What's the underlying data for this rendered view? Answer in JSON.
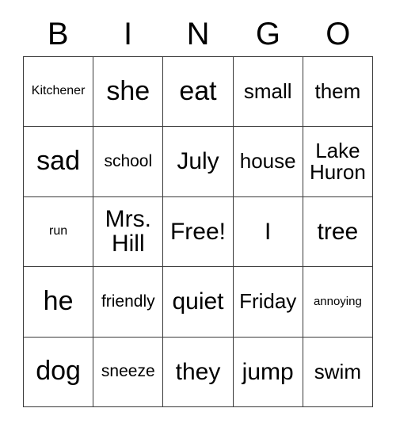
{
  "card": {
    "title_letters": [
      "B",
      "I",
      "N",
      "G",
      "O"
    ],
    "columns": 5,
    "rows": 5,
    "free_space_label": "Free!",
    "border_color": "#3a3a3a",
    "background_color": "#ffffff",
    "text_color": "#000000",
    "cells": [
      [
        {
          "text": "Kitchener",
          "size": "xs"
        },
        {
          "text": "she",
          "size": "xl"
        },
        {
          "text": "eat",
          "size": "xl"
        },
        {
          "text": "small",
          "size": "md"
        },
        {
          "text": "them",
          "size": "md"
        }
      ],
      [
        {
          "text": "sad",
          "size": "xl"
        },
        {
          "text": "school",
          "size": "sm"
        },
        {
          "text": "July",
          "size": "lg"
        },
        {
          "text": "house",
          "size": "md"
        },
        {
          "text": "Lake\nHuron",
          "size": "md"
        }
      ],
      [
        {
          "text": "run",
          "size": "xs"
        },
        {
          "text": "Mrs.\nHill",
          "size": "lg"
        },
        {
          "text": "Free!",
          "size": "lg"
        },
        {
          "text": "I",
          "size": "lg"
        },
        {
          "text": "tree",
          "size": "lg"
        }
      ],
      [
        {
          "text": "he",
          "size": "xl"
        },
        {
          "text": "friendly",
          "size": "sm"
        },
        {
          "text": "quiet",
          "size": "lg"
        },
        {
          "text": "Friday",
          "size": "md"
        },
        {
          "text": "annoying",
          "size": "xxs"
        }
      ],
      [
        {
          "text": "dog",
          "size": "xl"
        },
        {
          "text": "sneeze",
          "size": "sm"
        },
        {
          "text": "they",
          "size": "lg"
        },
        {
          "text": "jump",
          "size": "lg"
        },
        {
          "text": "swim",
          "size": "md"
        }
      ]
    ]
  }
}
